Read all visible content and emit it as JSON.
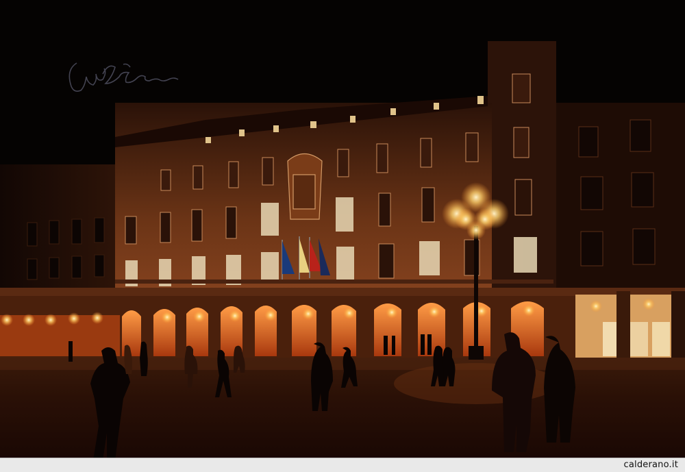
{
  "photo": {
    "subject": "plaza-at-night",
    "colors": {
      "sky": "#050302",
      "facade_light": "#8a4a22",
      "facade_dark": "#3a1a0c",
      "lamp_glow": "#ffd98a",
      "arch_glow": "#c45a1e",
      "pavement": "#2a1208",
      "window_lit": "#f2e0b0"
    },
    "signature_icon": "handwritten-signature-watermark"
  },
  "footer": {
    "credit_text": "calderano.it"
  }
}
